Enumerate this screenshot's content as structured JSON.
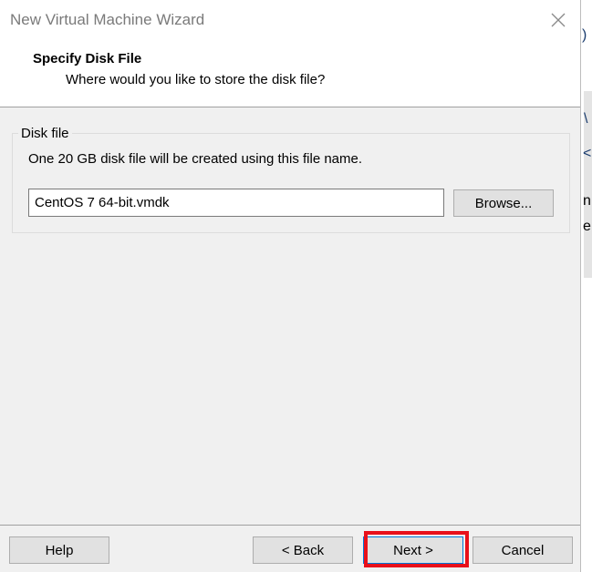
{
  "window": {
    "title": "New Virtual Machine Wizard"
  },
  "header": {
    "title": "Specify Disk File",
    "subtitle": "Where would you like to store the disk file?"
  },
  "disk_file_group": {
    "legend": "Disk file",
    "description": "One 20 GB disk file will be created using this file name.",
    "file_name_value": "CentOS 7 64-bit.vmdk",
    "browse_label": "Browse..."
  },
  "footer": {
    "help_label": "Help",
    "back_label": "< Back",
    "next_label": "Next >",
    "cancel_label": "Cancel"
  },
  "colors": {
    "highlight": "#e8101b",
    "dialog_bg": "#f0f0f0",
    "button_bg": "#e1e1e1"
  }
}
